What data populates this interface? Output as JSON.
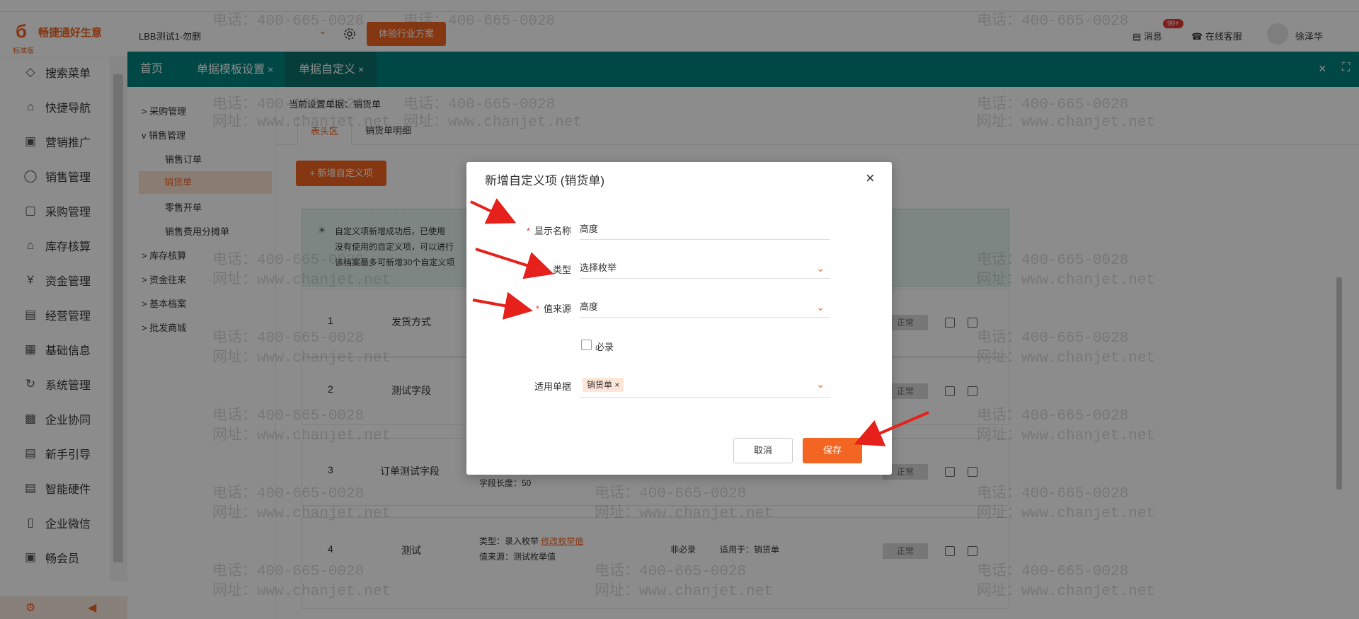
{
  "header": {
    "logo_text": "畅捷通好生意",
    "logo_sub": "标准版",
    "company": "LBB测试1-勿删",
    "industry_btn": "体验行业方案",
    "messages": "消息",
    "msg_badge": "99+",
    "service": "在线客服",
    "user": "徐泽华"
  },
  "sidebar": {
    "items": [
      {
        "label": "搜索菜单",
        "icon": "diamond-icon"
      },
      {
        "label": "快捷导航",
        "icon": "home-icon"
      },
      {
        "label": "营销推广",
        "icon": "gift-icon"
      },
      {
        "label": "销售管理",
        "icon": "tag-icon"
      },
      {
        "label": "采购管理",
        "icon": "bag-icon"
      },
      {
        "label": "库存核算",
        "icon": "warehouse-icon"
      },
      {
        "label": "资金管理",
        "icon": "money-icon"
      },
      {
        "label": "经营管理",
        "icon": "clipboard-icon"
      },
      {
        "label": "基础信息",
        "icon": "er-icon"
      },
      {
        "label": "系统管理",
        "icon": "refresh-icon"
      },
      {
        "label": "企业协同",
        "icon": "monitor-icon"
      },
      {
        "label": "新手引导",
        "icon": "guide-icon"
      },
      {
        "label": "智能硬件",
        "icon": "device-icon"
      },
      {
        "label": "企业微信",
        "icon": "phone-icon"
      },
      {
        "label": "畅会员",
        "icon": "member-icon"
      }
    ]
  },
  "tabs": [
    {
      "label": "首页"
    },
    {
      "label": "单据模板设置"
    },
    {
      "label": "单据自定义"
    }
  ],
  "tree": {
    "items": [
      {
        "label": "采购管理",
        "prefix": ">"
      },
      {
        "label": "销售管理",
        "prefix": "v"
      },
      {
        "label": "销售订单",
        "prefix": ""
      },
      {
        "label": "销货单",
        "prefix": ""
      },
      {
        "label": "零售开单",
        "prefix": ""
      },
      {
        "label": "销售费用分摊单",
        "prefix": ""
      },
      {
        "label": "库存核算",
        "prefix": ">"
      },
      {
        "label": "资金往来",
        "prefix": ">"
      },
      {
        "label": "基本档案",
        "prefix": ">"
      },
      {
        "label": "批发商城",
        "prefix": ">"
      }
    ]
  },
  "main": {
    "current_doc": "当前设置单据：销货单",
    "subtabs": [
      "表头区",
      "销货单明细"
    ],
    "add_btn": "+ 新增自定义项",
    "tip_lines": [
      "自定义项新增成功后，已使用",
      "没有使用的自定义项，可以进行",
      "该档案最多可新增30个自定义项"
    ],
    "rows": [
      {
        "index": "1",
        "name": "发货方式",
        "status": "正常"
      },
      {
        "index": "2",
        "name": "测试字段",
        "status": "正常"
      },
      {
        "index": "3",
        "name": "订单测试字段",
        "detail": "字段长度：50",
        "status": "正常"
      },
      {
        "index": "4",
        "name": "测试",
        "type_text": "类型：录入枚举",
        "edit_link": "修改枚举值",
        "source_text": "值来源：测试枚举值",
        "required": "非必录",
        "applies": "适用于：销货单",
        "status": "正常"
      }
    ]
  },
  "watermark": {
    "phone": "电话：400-665-0028",
    "site": "网址：www.chanjet.net"
  },
  "modal": {
    "title": "新增自定义项 (销货单)",
    "fields": {
      "display_name_label": "显示名称",
      "display_name_value": "高度",
      "type_label": "类型",
      "type_value": "选择枚举",
      "source_label": "值来源",
      "source_value": "高度",
      "required_label": "必录",
      "applies_label": "适用单据",
      "applies_tag": "销货单"
    },
    "cancel": "取消",
    "save": "保存"
  },
  "colors": {
    "accent": "#f26522",
    "tabbar": "#00847e",
    "annotation_arrow": "#e6201a"
  }
}
